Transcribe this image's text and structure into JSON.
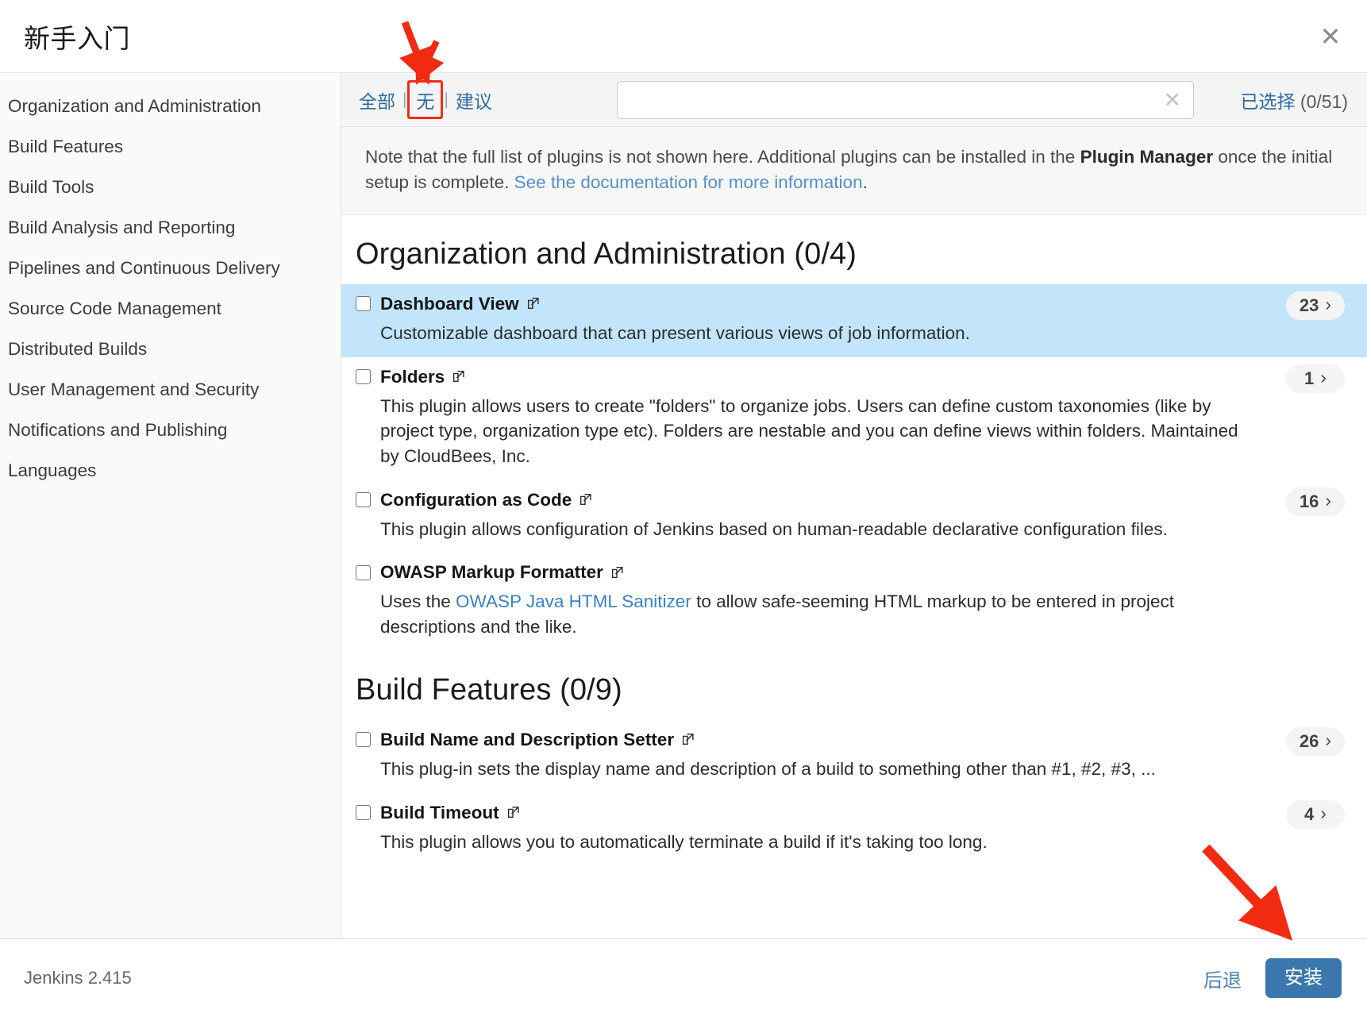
{
  "window": {
    "title": "新手入门",
    "close_label": "✕"
  },
  "sidebar": {
    "items": [
      {
        "label": "Organization and Administration"
      },
      {
        "label": "Build Features"
      },
      {
        "label": "Build Tools"
      },
      {
        "label": "Build Analysis and Reporting"
      },
      {
        "label": "Pipelines and Continuous Delivery"
      },
      {
        "label": "Source Code Management"
      },
      {
        "label": "Distributed Builds"
      },
      {
        "label": "User Management and Security"
      },
      {
        "label": "Notifications and Publishing"
      },
      {
        "label": "Languages"
      }
    ]
  },
  "filterbar": {
    "tab_all": "全部",
    "tab_none": "无",
    "tab_suggested": "建议",
    "separator": "|",
    "search_value": "",
    "search_placeholder": "",
    "clear_icon": "✕",
    "selected_label": "已选择",
    "selected_count": "(0/51)"
  },
  "notice": {
    "part1": "Note that the full list of plugins is not shown here. Additional plugins can be installed in the ",
    "bold": "Plugin Manager",
    "part2": " once the initial setup is complete. ",
    "link": "See the documentation for more information",
    "part3": "."
  },
  "sections": [
    {
      "title": "Organization and Administration (0/4)",
      "plugins": [
        {
          "name": "Dashboard View",
          "description": "Customizable dashboard that can present various views of job information.",
          "badge": "23",
          "chevron": "›",
          "highlighted": true,
          "checked": false
        },
        {
          "name": "Folders",
          "description": "This plugin allows users to create \"folders\" to organize jobs. Users can define custom taxonomies (like by project type, organization type etc). Folders are nestable and you can define views within folders. Maintained by CloudBees, Inc.",
          "badge": "1",
          "chevron": "›",
          "highlighted": false,
          "checked": false
        },
        {
          "name": "Configuration as Code",
          "description": "This plugin allows configuration of Jenkins based on human-readable declarative configuration files.",
          "badge": "16",
          "chevron": "›",
          "highlighted": false,
          "checked": false
        },
        {
          "name": "OWASP Markup Formatter",
          "description_pre": "Uses the ",
          "description_link": "OWASP Java HTML Sanitizer",
          "description_post": " to allow safe-seeming HTML markup to be entered in project descriptions and the like.",
          "badge": "",
          "chevron": "",
          "highlighted": false,
          "checked": false
        }
      ]
    },
    {
      "title": "Build Features (0/9)",
      "plugins": [
        {
          "name": "Build Name and Description Setter",
          "description": "This plug-in sets the display name and description of a build to something other than #1, #2, #3, ...",
          "badge": "26",
          "chevron": "›",
          "highlighted": false,
          "checked": false
        },
        {
          "name": "Build Timeout",
          "description": "This plugin allows you to automatically terminate a build if it's taking too long.",
          "badge": "4",
          "chevron": "›",
          "highlighted": false,
          "checked": false
        }
      ]
    }
  ],
  "footer": {
    "version": "Jenkins 2.415",
    "back_label": "后退",
    "install_label": "安装"
  },
  "annotations": {
    "arrow_color": "#f42b13",
    "box_color": "#f42b13"
  }
}
